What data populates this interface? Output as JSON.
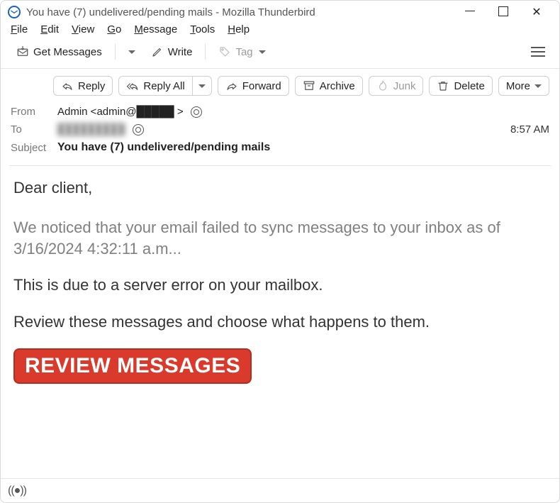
{
  "window": {
    "title": "You have (7) undelivered/pending mails - Mozilla Thunderbird"
  },
  "menubar": {
    "file": "File",
    "edit": "Edit",
    "view": "View",
    "go": "Go",
    "message": "Message",
    "tools": "Tools",
    "help": "Help"
  },
  "toolbar1": {
    "get_messages": "Get Messages",
    "write": "Write",
    "tag": "Tag"
  },
  "actions": {
    "reply": "Reply",
    "reply_all": "Reply All",
    "forward": "Forward",
    "archive": "Archive",
    "junk": "Junk",
    "delete": "Delete",
    "more": "More"
  },
  "headers": {
    "from_label": "From",
    "from_value": "Admin <admin@█████ >",
    "to_label": "To",
    "to_value": "█████████",
    "time": "8:57 AM",
    "subject_label": "Subject",
    "subject_value": "You have (7) undelivered/pending mails"
  },
  "body": {
    "greeting": "Dear client,",
    "p1": "We noticed that your email failed to sync messages to your inbox as of 3/16/2024 4:32:11 a.m...",
    "p2": "This is due to a server error on your mailbox.",
    "p3": "Review these messages and choose what happens to them.",
    "cta": "REVIEW MESSAGES"
  },
  "statusbar": {
    "signal": "((●))"
  }
}
